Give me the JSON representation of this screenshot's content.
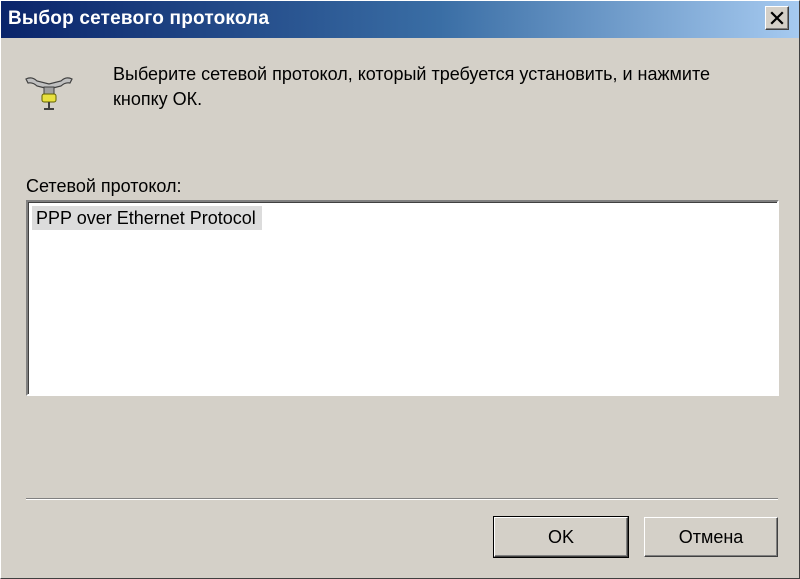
{
  "window": {
    "title": "Выбор сетевого протокола",
    "close_icon": "close-icon"
  },
  "header": {
    "icon": "network-connector-icon",
    "instruction": "Выберите сетевой протокол, который требуется установить, и нажмите кнопку ОК."
  },
  "protocol_list": {
    "label": "Сетевой протокол:",
    "items": [
      {
        "label": "PPP over Ethernet Protocol",
        "selected": true
      }
    ]
  },
  "buttons": {
    "ok_label": "OK",
    "cancel_label": "Отмена"
  },
  "colors": {
    "titlebar_start": "#0a246a",
    "titlebar_end": "#a6caf0",
    "dialog_bg": "#d4d0c8",
    "selection_bg": "#dcdcdc"
  }
}
